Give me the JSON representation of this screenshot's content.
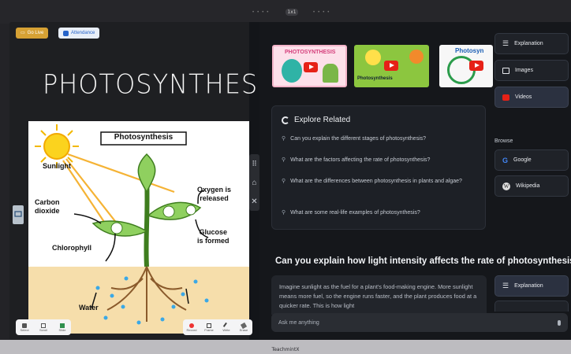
{
  "device": {
    "camera_label": "1x1",
    "brand": "TeachmintX"
  },
  "board": {
    "go_live_label": "Go Live",
    "attendance_label": "Attendance",
    "title": "PHOTOSYNTHESIS",
    "diagram": {
      "heading": "Photosynthesis",
      "labels": {
        "sunlight": "Sunlight",
        "carbon_dioxide": "Carbon\ndioxide",
        "chlorophyll": "Chlorophyll",
        "oxygen": "Oxygen is\nreleased",
        "glucose": "Glucose\nis formed",
        "water": "Water"
      }
    },
    "toolbar_left": [
      {
        "icon": "select-icon",
        "label": "Select"
      },
      {
        "icon": "scroll-icon",
        "label": "Scroll"
      },
      {
        "icon": "slide-icon",
        "label": "Slide"
      }
    ],
    "toolbar_right": [
      {
        "icon": "record-icon",
        "label": "Record"
      },
      {
        "icon": "frame-icon",
        "label": "Frame"
      },
      {
        "icon": "pen-icon",
        "label": "Write"
      },
      {
        "icon": "eraser-icon",
        "label": "Erase"
      }
    ]
  },
  "panel": {
    "videos": [
      {
        "title": "PHOTOSYNTHESIS"
      },
      {
        "title": "Photosynthesis"
      },
      {
        "title": "Photosyn"
      }
    ],
    "explore": {
      "heading": "Explore Related",
      "questions": [
        "Can you explain the different stages of photosynthesis?",
        "What are the factors affecting the rate of photosynthesis?",
        "What are the differences between photosynthesis in plants and algae?",
        "What are some real-life examples of photosynthesis?"
      ]
    },
    "side_buttons": {
      "explanation": "Explanation",
      "images": "Images",
      "videos": "Videos",
      "browse_label": "Browse",
      "google": "Google",
      "wikipedia": "Wikipedia",
      "explanation_2": "Explanation"
    },
    "question": "Can you explain how light intensity affects the rate of photosynthesis?",
    "answer": "Imagine sunlight as the fuel for a plant's food-making engine. More sunlight means more fuel, so the engine runs faster, and the plant produces food at a quicker rate. This is how light",
    "ask_placeholder": "Ask me anything"
  },
  "colors": {
    "go_live": "#d6a134",
    "attendance_text": "#2563c9",
    "youtube_red": "#e62117",
    "panel_bg": "#15171b"
  }
}
